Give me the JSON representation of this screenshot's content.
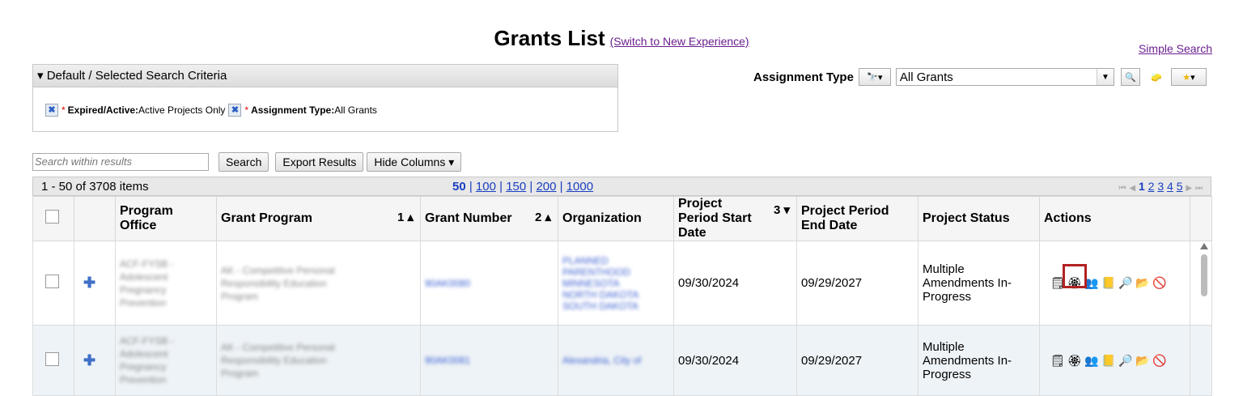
{
  "title": "Grants List",
  "switch_link": "(Switch to New Experience)",
  "simple_search": "Simple Search",
  "criteria": {
    "header": "▾ Default / Selected Search Criteria",
    "items": [
      {
        "label": "Expired/Active:",
        "value": "Active Projects Only"
      },
      {
        "label": "Assignment Type:",
        "value": "All Grants"
      }
    ]
  },
  "assignment": {
    "label": "Assignment Type",
    "selected": "All Grants"
  },
  "toolbar": {
    "search_placeholder": "Search within results",
    "search_button": "Search",
    "export_button": "Export Results",
    "hide_columns_button": "Hide Columns ▾"
  },
  "pager": {
    "items_count": "1 - 50 of 3708 items",
    "page_sizes": [
      "50",
      "100",
      "150",
      "200",
      "1000"
    ],
    "pages": [
      "1",
      "2",
      "3",
      "4",
      "5"
    ]
  },
  "columns": {
    "program_office": "Program Office",
    "grant_program": "Grant Program",
    "grant_program_sort": "1 ▴",
    "grant_number": "Grant Number",
    "grant_number_sort": "2 ▴",
    "organization": "Organization",
    "start_date": "Project Period Start Date",
    "start_date_sort": "3 ▾",
    "end_date": "Project Period End Date",
    "status": "Project Status",
    "actions": "Actions"
  },
  "rows": [
    {
      "start_date": "09/30/2024",
      "end_date": "09/29/2027",
      "status": "Multiple Amendments In-Progress"
    },
    {
      "start_date": "09/30/2024",
      "end_date": "09/29/2027",
      "status": "Multiple Amendments In-Progress"
    }
  ],
  "colors": {
    "link_purple": "#6b1f8f",
    "link_blue": "#1a3fc0",
    "highlight_red": "#b22222",
    "row_alt": "#eef3f7"
  }
}
